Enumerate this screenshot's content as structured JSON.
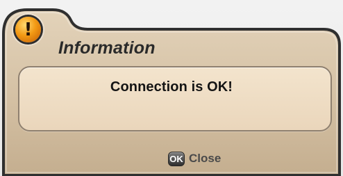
{
  "dialog": {
    "icon": "warning-icon",
    "icon_symbol": "!",
    "title": "Information",
    "message": "Connection is OK!",
    "footer": {
      "ok_key_label": "OK",
      "close_label": "Close"
    },
    "colors": {
      "panel": "#d6c4a9",
      "panel_dark": "#c8b395",
      "message_box": "#f0dfc5",
      "outline": "#2f2f2f",
      "icon_orange": "#f39a14"
    }
  }
}
